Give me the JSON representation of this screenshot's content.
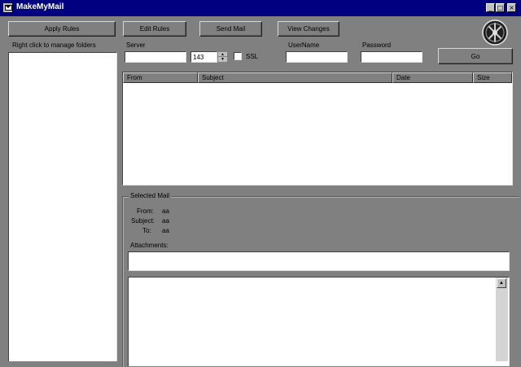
{
  "window": {
    "title": "MakeMyMail",
    "minimize_glyph": "_",
    "maximize_glyph": "□",
    "close_glyph": "×"
  },
  "toolbar": {
    "apply_rules": "Apply Rules",
    "edit_rules": "Edit Rules",
    "send_mail": "Send Mail",
    "view_changes": "View Changes",
    "go": "Go"
  },
  "folders": {
    "hint": "Right click to manage folders"
  },
  "connection": {
    "server_label": "Server",
    "server_value": "",
    "port_value": "143",
    "ssl_label": "SSL",
    "ssl_checked": false,
    "username_label": "UserName",
    "username_value": "",
    "password_label": "Password",
    "password_value": ""
  },
  "mail_list": {
    "columns": [
      "From",
      "Subject",
      "Date",
      "Size"
    ],
    "rows": []
  },
  "selected_mail": {
    "group_label": "Selected Mail",
    "from_label": "From:",
    "from_value": "aa",
    "subject_label": "Subject:",
    "subject_value": "aa",
    "to_label": "To:",
    "to_value": "aa",
    "attachments_label": "Attachments:",
    "attachments_value": "",
    "body": ""
  },
  "icons": {
    "app": "mail-app-icon",
    "logo": "wheel-logo-icon"
  },
  "colors": {
    "titlebar": "#000080",
    "window_background": "#808080"
  }
}
